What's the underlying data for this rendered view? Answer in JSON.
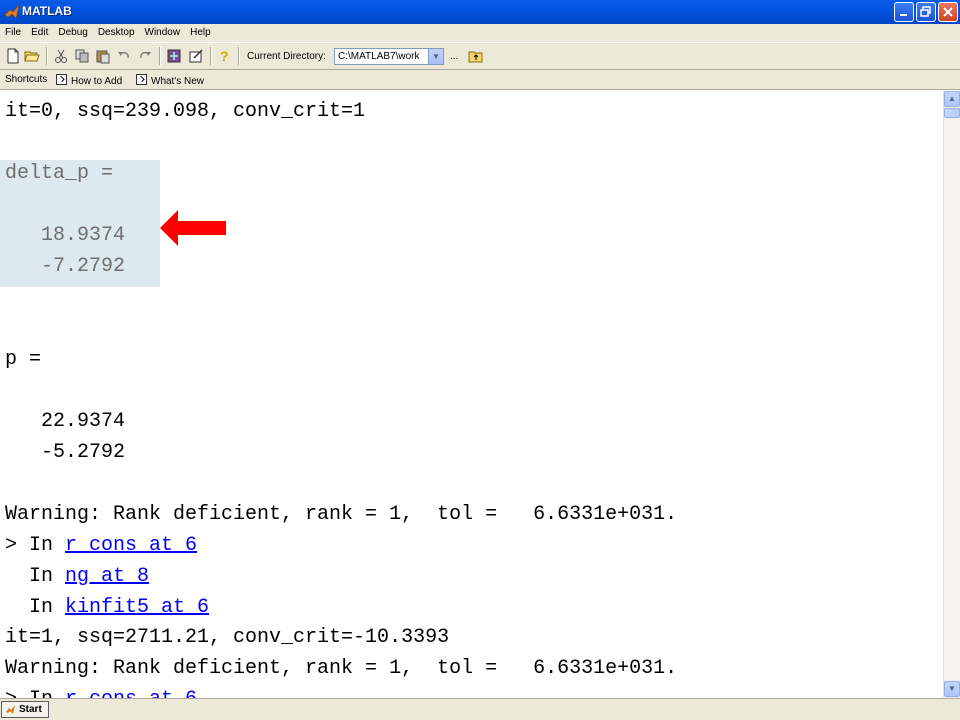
{
  "window": {
    "title": "MATLAB"
  },
  "menu": [
    "File",
    "Edit",
    "Debug",
    "Desktop",
    "Window",
    "Help"
  ],
  "toolbar": {
    "current_directory_label": "Current Directory:",
    "current_directory_value": "C:\\MATLAB7\\work",
    "browse_label": "..."
  },
  "shortcuts": {
    "label": "Shortcuts",
    "items": [
      "How to Add",
      "What's New"
    ]
  },
  "command_window": {
    "line1": "it=0, ssq=239.098, conv_crit=1",
    "delta_p_header": "delta_p =",
    "delta_p_values": [
      "   18.9374",
      "   -7.2792"
    ],
    "p_header": "p =",
    "p_values": [
      "   22.9374",
      "   -5.2792"
    ],
    "warning1": "Warning: Rank deficient, rank = 1,  tol =   6.6331e+031.",
    "trace1_prefix": "> In ",
    "trace1_link": "r_cons at 6",
    "trace2_prefix": "  In ",
    "trace2_link": "ng at 8",
    "trace3_prefix": "  In ",
    "trace3_link": "kinfit5 at 6",
    "line_it1": "it=1, ssq=2711.21, conv_crit=-10.3393",
    "warning2": "Warning: Rank deficient, rank = 1,  tol =   6.6331e+031.",
    "trace4_prefix": "> In ",
    "trace4_link": "r_cons at 6"
  },
  "annotation": {
    "arrow_color": "#ff0000",
    "highlight_color": "#dce9ee"
  },
  "statusbar": {
    "start_label": "Start"
  }
}
